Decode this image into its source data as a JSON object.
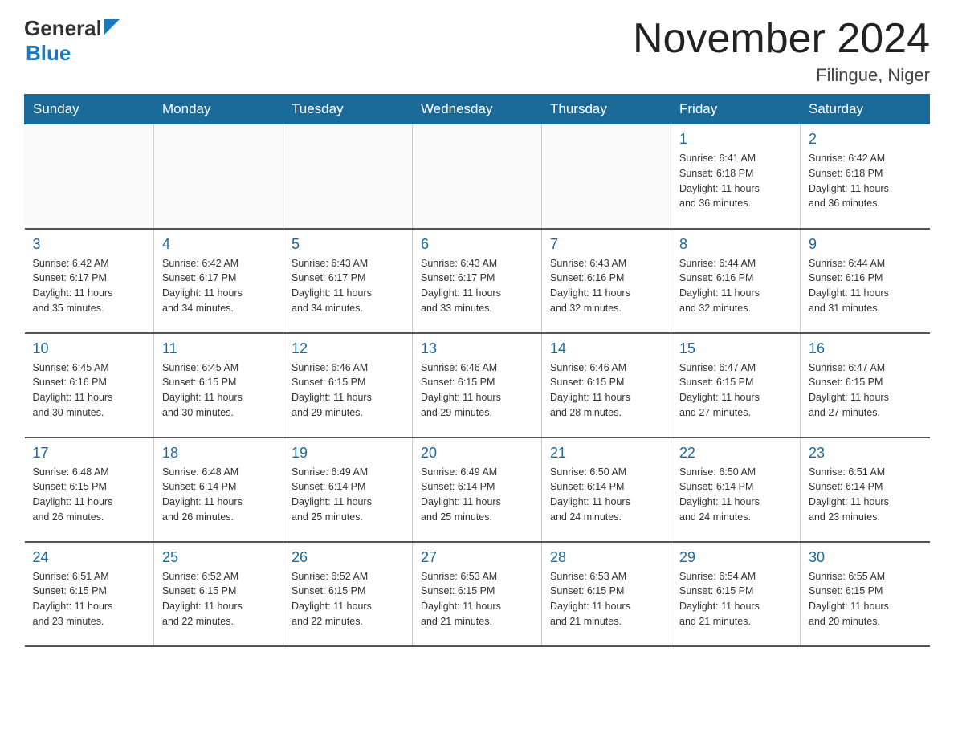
{
  "header": {
    "logo_general": "General",
    "logo_blue": "Blue",
    "month_title": "November 2024",
    "location": "Filingue, Niger"
  },
  "weekdays": [
    "Sunday",
    "Monday",
    "Tuesday",
    "Wednesday",
    "Thursday",
    "Friday",
    "Saturday"
  ],
  "weeks": [
    [
      {
        "day": "",
        "info": ""
      },
      {
        "day": "",
        "info": ""
      },
      {
        "day": "",
        "info": ""
      },
      {
        "day": "",
        "info": ""
      },
      {
        "day": "",
        "info": ""
      },
      {
        "day": "1",
        "info": "Sunrise: 6:41 AM\nSunset: 6:18 PM\nDaylight: 11 hours\nand 36 minutes."
      },
      {
        "day": "2",
        "info": "Sunrise: 6:42 AM\nSunset: 6:18 PM\nDaylight: 11 hours\nand 36 minutes."
      }
    ],
    [
      {
        "day": "3",
        "info": "Sunrise: 6:42 AM\nSunset: 6:17 PM\nDaylight: 11 hours\nand 35 minutes."
      },
      {
        "day": "4",
        "info": "Sunrise: 6:42 AM\nSunset: 6:17 PM\nDaylight: 11 hours\nand 34 minutes."
      },
      {
        "day": "5",
        "info": "Sunrise: 6:43 AM\nSunset: 6:17 PM\nDaylight: 11 hours\nand 34 minutes."
      },
      {
        "day": "6",
        "info": "Sunrise: 6:43 AM\nSunset: 6:17 PM\nDaylight: 11 hours\nand 33 minutes."
      },
      {
        "day": "7",
        "info": "Sunrise: 6:43 AM\nSunset: 6:16 PM\nDaylight: 11 hours\nand 32 minutes."
      },
      {
        "day": "8",
        "info": "Sunrise: 6:44 AM\nSunset: 6:16 PM\nDaylight: 11 hours\nand 32 minutes."
      },
      {
        "day": "9",
        "info": "Sunrise: 6:44 AM\nSunset: 6:16 PM\nDaylight: 11 hours\nand 31 minutes."
      }
    ],
    [
      {
        "day": "10",
        "info": "Sunrise: 6:45 AM\nSunset: 6:16 PM\nDaylight: 11 hours\nand 30 minutes."
      },
      {
        "day": "11",
        "info": "Sunrise: 6:45 AM\nSunset: 6:15 PM\nDaylight: 11 hours\nand 30 minutes."
      },
      {
        "day": "12",
        "info": "Sunrise: 6:46 AM\nSunset: 6:15 PM\nDaylight: 11 hours\nand 29 minutes."
      },
      {
        "day": "13",
        "info": "Sunrise: 6:46 AM\nSunset: 6:15 PM\nDaylight: 11 hours\nand 29 minutes."
      },
      {
        "day": "14",
        "info": "Sunrise: 6:46 AM\nSunset: 6:15 PM\nDaylight: 11 hours\nand 28 minutes."
      },
      {
        "day": "15",
        "info": "Sunrise: 6:47 AM\nSunset: 6:15 PM\nDaylight: 11 hours\nand 27 minutes."
      },
      {
        "day": "16",
        "info": "Sunrise: 6:47 AM\nSunset: 6:15 PM\nDaylight: 11 hours\nand 27 minutes."
      }
    ],
    [
      {
        "day": "17",
        "info": "Sunrise: 6:48 AM\nSunset: 6:15 PM\nDaylight: 11 hours\nand 26 minutes."
      },
      {
        "day": "18",
        "info": "Sunrise: 6:48 AM\nSunset: 6:14 PM\nDaylight: 11 hours\nand 26 minutes."
      },
      {
        "day": "19",
        "info": "Sunrise: 6:49 AM\nSunset: 6:14 PM\nDaylight: 11 hours\nand 25 minutes."
      },
      {
        "day": "20",
        "info": "Sunrise: 6:49 AM\nSunset: 6:14 PM\nDaylight: 11 hours\nand 25 minutes."
      },
      {
        "day": "21",
        "info": "Sunrise: 6:50 AM\nSunset: 6:14 PM\nDaylight: 11 hours\nand 24 minutes."
      },
      {
        "day": "22",
        "info": "Sunrise: 6:50 AM\nSunset: 6:14 PM\nDaylight: 11 hours\nand 24 minutes."
      },
      {
        "day": "23",
        "info": "Sunrise: 6:51 AM\nSunset: 6:14 PM\nDaylight: 11 hours\nand 23 minutes."
      }
    ],
    [
      {
        "day": "24",
        "info": "Sunrise: 6:51 AM\nSunset: 6:15 PM\nDaylight: 11 hours\nand 23 minutes."
      },
      {
        "day": "25",
        "info": "Sunrise: 6:52 AM\nSunset: 6:15 PM\nDaylight: 11 hours\nand 22 minutes."
      },
      {
        "day": "26",
        "info": "Sunrise: 6:52 AM\nSunset: 6:15 PM\nDaylight: 11 hours\nand 22 minutes."
      },
      {
        "day": "27",
        "info": "Sunrise: 6:53 AM\nSunset: 6:15 PM\nDaylight: 11 hours\nand 21 minutes."
      },
      {
        "day": "28",
        "info": "Sunrise: 6:53 AM\nSunset: 6:15 PM\nDaylight: 11 hours\nand 21 minutes."
      },
      {
        "day": "29",
        "info": "Sunrise: 6:54 AM\nSunset: 6:15 PM\nDaylight: 11 hours\nand 21 minutes."
      },
      {
        "day": "30",
        "info": "Sunrise: 6:55 AM\nSunset: 6:15 PM\nDaylight: 11 hours\nand 20 minutes."
      }
    ]
  ]
}
